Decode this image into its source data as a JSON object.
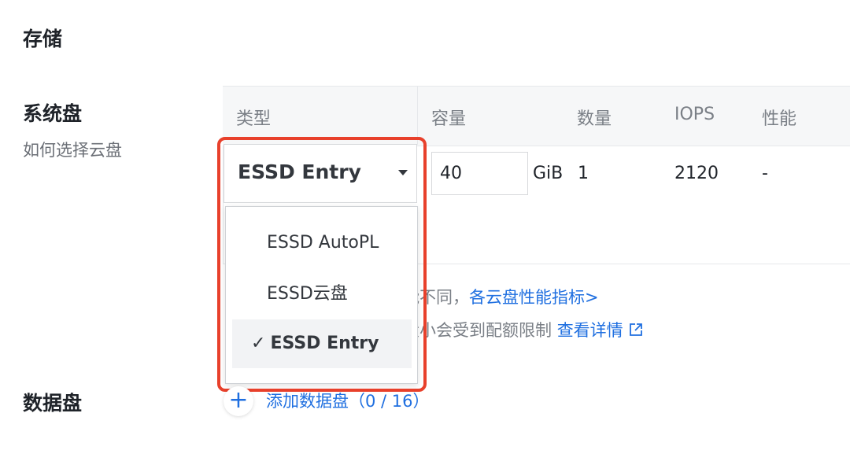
{
  "storage": {
    "title": "存储"
  },
  "system_disk": {
    "title": "系统盘",
    "help_link": "如何选择云盘",
    "table": {
      "headers": [
        "类型",
        "容量",
        "数量",
        "IOPS",
        "性能"
      ],
      "row": {
        "type": "ESSD Entry",
        "capacity": "40",
        "unit": "GiB",
        "quantity": "1",
        "iops": "2120",
        "performance": "-"
      }
    },
    "dropdown": {
      "options": [
        {
          "label": "ESSD AutoPL",
          "selected": false
        },
        {
          "label": "ESSD云盘",
          "selected": false
        },
        {
          "label": "ESSD Entry",
          "selected": true
        }
      ],
      "check_mark": "✓"
    },
    "info_line_1": {
      "text": "能不同，",
      "link": "各云盘性能指标>"
    },
    "info_line_2": {
      "text": "大小会受到配额限制",
      "link": "查看详情",
      "link_icon": "external-link-icon"
    }
  },
  "data_disk": {
    "title": "数据盘",
    "add_icon": "+",
    "add_label": "添加数据盘（0 / 16）"
  },
  "colors": {
    "accent": "#1f6fe0",
    "highlight": "#e8402b"
  }
}
